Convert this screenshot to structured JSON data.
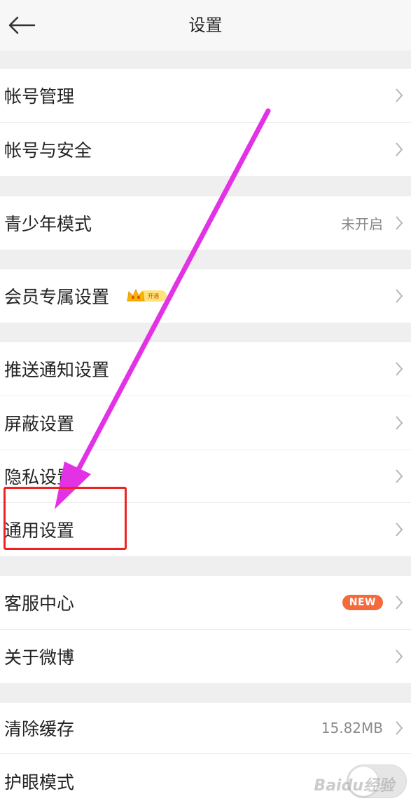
{
  "header": {
    "title": "设置",
    "back_icon": "arrow-left-icon"
  },
  "groups": [
    {
      "items": [
        {
          "label": "帐号管理"
        },
        {
          "label": "帐号与安全"
        }
      ]
    },
    {
      "items": [
        {
          "label": "青少年模式",
          "value": "未开启"
        }
      ]
    },
    {
      "items": [
        {
          "label": "会员专属设置",
          "badge": "开通",
          "badge_icon": "vip-crown-icon"
        }
      ]
    },
    {
      "items": [
        {
          "label": "推送通知设置"
        },
        {
          "label": "屏蔽设置"
        },
        {
          "label": "隐私设置"
        },
        {
          "label": "通用设置"
        }
      ]
    },
    {
      "items": [
        {
          "label": "客服中心",
          "badge": "NEW"
        },
        {
          "label": "关于微博"
        }
      ]
    },
    {
      "items": [
        {
          "label": "清除缓存",
          "value": "15.82MB"
        },
        {
          "label": "护眼模式",
          "toggle": false
        }
      ]
    }
  ],
  "annotation": {
    "arrow_color": "#e331e6",
    "box_color": "#ee2222"
  },
  "watermark": "Baidu经验",
  "colors": {
    "background": "#efefef",
    "row_bg": "#ffffff",
    "new_badge": "#f46a3d",
    "value_text": "#8a8a8a"
  }
}
